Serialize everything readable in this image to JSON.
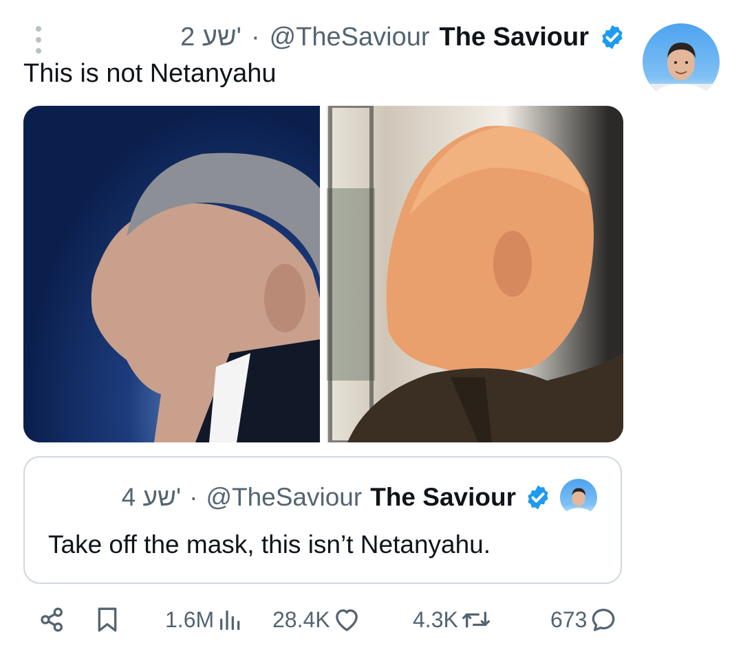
{
  "tweet": {
    "menu_icon": "more-vertical-icon",
    "time": "2 שע'",
    "separator": "·",
    "handle": "@TheSaviour",
    "display_name": "The Saviour",
    "verified_icon": "verified-badge-icon",
    "text": "This is not Netanyahu"
  },
  "quoted_tweet": {
    "time": "4 שע'",
    "separator": "·",
    "handle": "@TheSaviour",
    "display_name": "The Saviour",
    "verified_icon": "verified-badge-icon",
    "text": "Take off the mask, this isn’t Netanyahu."
  },
  "actions": {
    "share_icon": "share-icon",
    "bookmark_icon": "bookmark-icon",
    "views": "1.6M",
    "likes": "28.4K",
    "retweets": "4.3K",
    "replies": "673"
  },
  "colors": {
    "accent": "#1d9bf0",
    "muted_text": "#536471",
    "text": "#0f1419",
    "border": "#cfd9de"
  }
}
